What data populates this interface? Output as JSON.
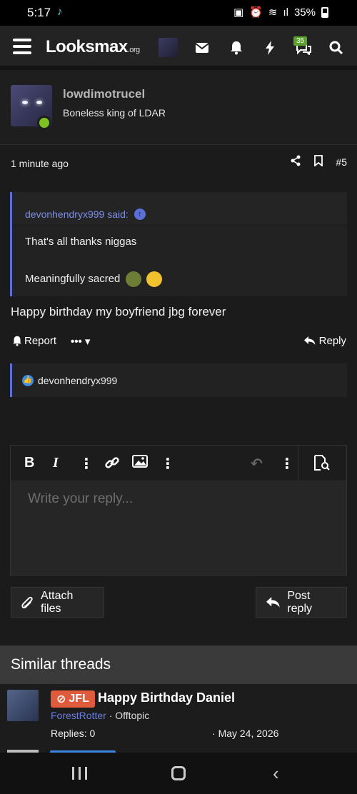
{
  "status": {
    "time": "5:17",
    "battery": "35%"
  },
  "header": {
    "logo_main": "Looksmax",
    "logo_suffix": ".org",
    "conversations_badge": "35"
  },
  "post": {
    "username": "lowdimotrucel",
    "user_title": "Boneless king of LDAR",
    "time": "1 minute ago",
    "number": "#5",
    "quote": {
      "author_said": "devonhendryx999 said:",
      "line1": "That's all thanks niggas",
      "line2": "Meaningfully sacred"
    },
    "message": "Happy birthday my boyfriend jbg forever",
    "report_label": "Report",
    "more_label": "•••",
    "reply_label": "Reply",
    "reaction_user": "devonhendryx999"
  },
  "editor": {
    "placeholder": "Write your reply...",
    "attach_label": "Attach files",
    "post_reply_label": "Post reply"
  },
  "similar": {
    "heading": "Similar threads",
    "threads": [
      {
        "prefix": "JFL",
        "title": "Happy Birthday Daniel",
        "author": "ForestRotter",
        "forum": "Offtopic",
        "replies": "Replies: 0",
        "date": "May 24, 2026"
      }
    ]
  },
  "colors": {
    "accent": "#5c6fd6",
    "online": "#7ec222",
    "prefix_jfl": "#e05b3b",
    "badge": "#5aa12d"
  }
}
